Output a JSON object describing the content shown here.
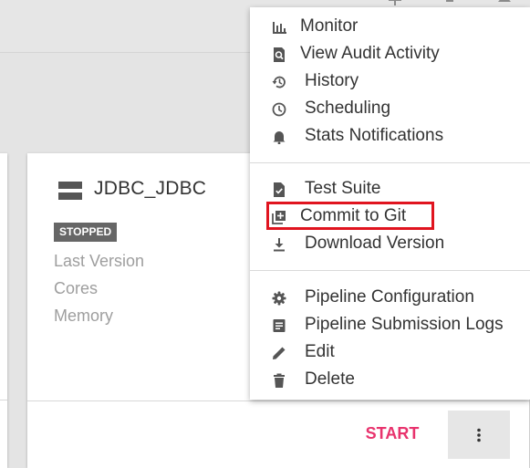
{
  "card": {
    "title": "JDBC_JDBC",
    "status": "STOPPED",
    "meta_labels": [
      "Last Version",
      "Cores",
      "Memory"
    ],
    "start_label": "START",
    "more_icon": "more-vert-icon",
    "pipeline_icon": "pipeline-icon"
  },
  "menu": {
    "items": [
      {
        "label": "Monitor",
        "icon": "bar-chart-icon"
      },
      {
        "label": "View Audit Activity",
        "icon": "search-document-icon"
      },
      {
        "label": "History",
        "icon": "history-icon"
      },
      {
        "label": "Scheduling",
        "icon": "clock-icon"
      },
      {
        "label": "Stats Notifications",
        "icon": "bell-icon"
      },
      {
        "label": "Test Suite",
        "icon": "checked-document-icon"
      },
      {
        "label": "Commit to Git",
        "icon": "add-to-library-icon"
      },
      {
        "label": "Download Version",
        "icon": "download-icon"
      },
      {
        "label": "Pipeline Configuration",
        "icon": "gear-icon"
      },
      {
        "label": "Pipeline Submission Logs",
        "icon": "log-document-icon"
      },
      {
        "label": "Edit",
        "icon": "pencil-icon"
      },
      {
        "label": "Delete",
        "icon": "trash-icon"
      }
    ]
  },
  "colors": {
    "accent": "#e8336d",
    "highlight": "#e0141f",
    "badge": "#666666",
    "icon": "#555555"
  }
}
